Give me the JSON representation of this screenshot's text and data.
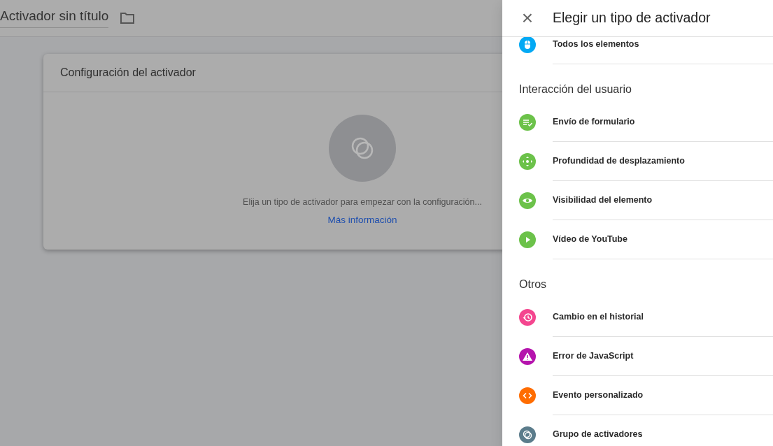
{
  "editor": {
    "title": "Activador sin título"
  },
  "card": {
    "title": "Configuración del activador",
    "message": "Elija un tipo de activador para empezar con la configuración...",
    "link": "Más información"
  },
  "panel": {
    "close": "×",
    "title": "Elegir un tipo de activador",
    "sections": [
      {
        "items": [
          {
            "label": "Todos los elementos",
            "kind": "click",
            "color": "#03a9f4"
          }
        ]
      },
      {
        "heading": "Interacción del usuario",
        "items": [
          {
            "label": "Envío de formulario",
            "kind": "form",
            "color": "#6cc24a"
          },
          {
            "label": "Profundidad de desplazamiento",
            "kind": "scroll",
            "color": "#6cc24a"
          },
          {
            "label": "Visibilidad del elemento",
            "kind": "visibility",
            "color": "#6cc24a"
          },
          {
            "label": "Vídeo de YouTube",
            "kind": "video",
            "color": "#6cc24a"
          }
        ]
      },
      {
        "heading": "Otros",
        "items": [
          {
            "label": "Cambio en el historial",
            "kind": "history",
            "color": "#f4468f"
          },
          {
            "label": "Error de JavaScript",
            "kind": "error",
            "color": "#b514ad"
          },
          {
            "label": "Evento personalizado",
            "kind": "custom",
            "color": "#ff6d00"
          },
          {
            "label": "Grupo de activadores",
            "kind": "group",
            "color": "#5b7c8b"
          }
        ]
      }
    ]
  }
}
